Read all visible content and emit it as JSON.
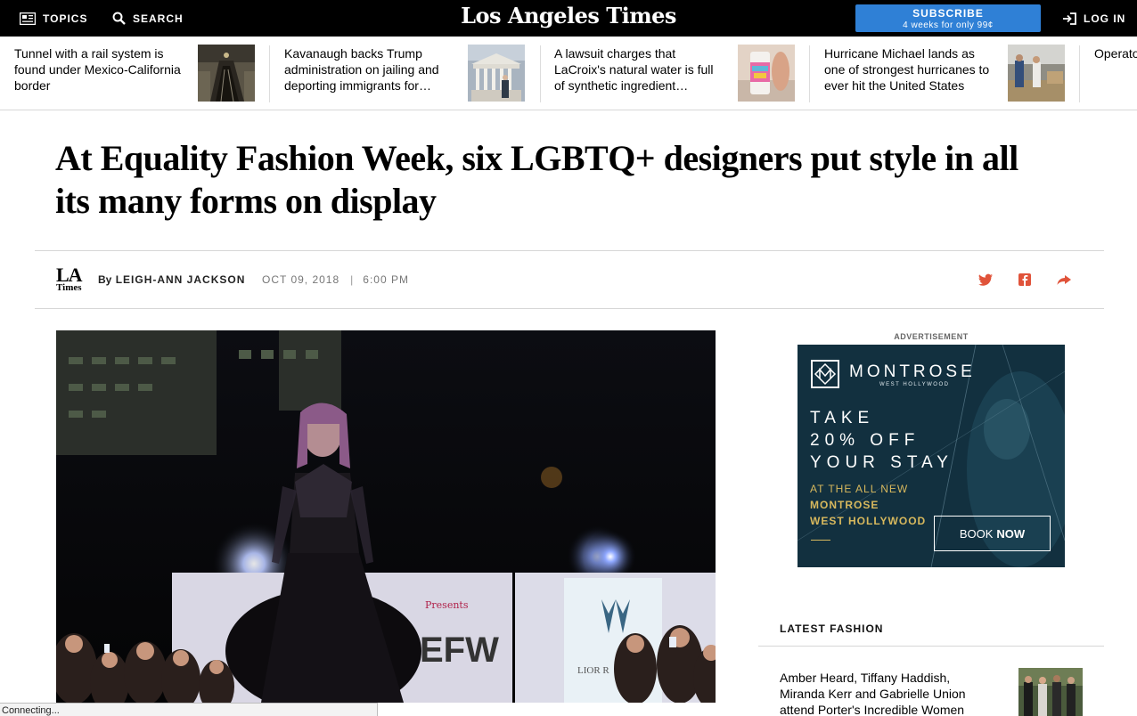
{
  "nav": {
    "topics_label": "TOPICS",
    "search_label": "SEARCH",
    "logo_text": "Los Angeles Times",
    "subscribe_label": "SUBSCRIBE",
    "subscribe_offer": "4 weeks for only 99¢",
    "login_label": "LOG IN"
  },
  "rail": {
    "items": [
      {
        "text": "Tunnel with a rail system is found under Mexico-California border",
        "thumb_icon": "tunnel-photo"
      },
      {
        "text": "Kavanaugh backs Trump administration on jailing and deporting immigrants for…",
        "thumb_icon": "supreme-court-photo"
      },
      {
        "text": "A lawsuit charges that LaCroix's natural water is full of synthetic ingredient…",
        "thumb_icon": "lacroix-can-photo"
      },
      {
        "text": "Hurricane Michael lands as one of strongest hurricanes to ever hit the United States",
        "thumb_icon": "hurricane-photo"
      },
      {
        "text": "Operato involved that kill",
        "thumb_icon": ""
      }
    ]
  },
  "article": {
    "headline": "At Equality Fashion Week, six LGBTQ+ designers put style in all its many forms on display",
    "byline_prefix": "By",
    "author": "LEIGH-ANN JACKSON",
    "date": "OCT 09, 2018",
    "separator": "|",
    "time": "6:00 PM",
    "logo_la": "LA",
    "logo_times": "Times",
    "share_icons": [
      "twitter-icon",
      "facebook-icon",
      "share-icon"
    ]
  },
  "photo": {
    "backdrop_logo": "EFW",
    "backdrop_presents": "Presents",
    "backdrop_brand": "LIOR R"
  },
  "ad": {
    "label": "ADVERTISEMENT",
    "brand": "MONTROSE",
    "brand_sub": "WEST HOLLYWOOD",
    "offer_lines": [
      "TAKE",
      "20% OFF",
      "YOUR STAY"
    ],
    "tag1": "AT THE ALL NEW",
    "tag2": "MONTROSE",
    "tag3": "WEST HOLLYWOOD",
    "cta_light": "BOOK",
    "cta_bold": "NOW",
    "colors": {
      "background": "#12303f",
      "gold": "#d7b85d"
    }
  },
  "latest": {
    "heading": "LATEST FASHION",
    "item_text": "Amber Heard, Tiffany Haddish, Miranda Kerr and Gabrielle Union attend Porter's Incredible Women"
  },
  "status_bar": "Connecting...",
  "colors": {
    "nav_bg": "#000000",
    "subscribe": "#2f80d6",
    "share_red": "#e0533a"
  }
}
